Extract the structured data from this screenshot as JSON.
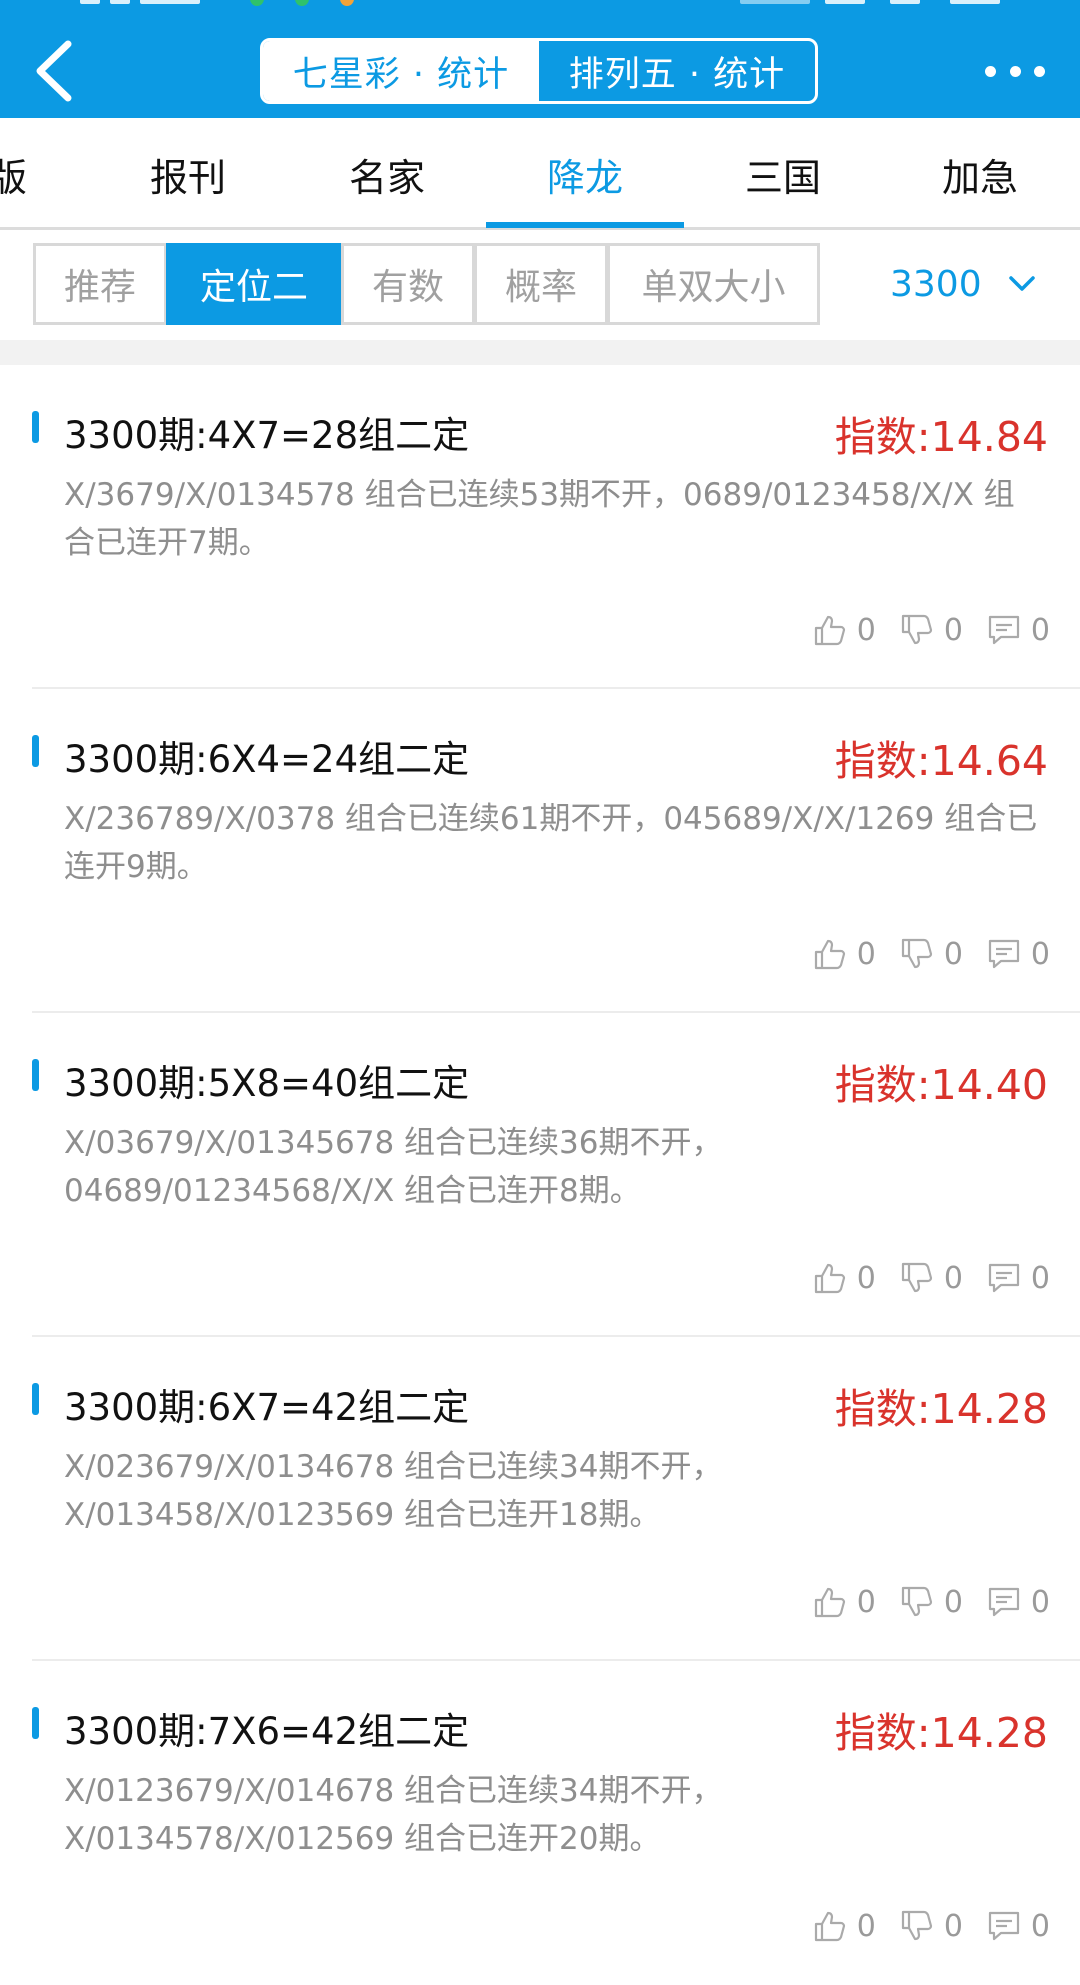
{
  "header": {
    "segments": [
      {
        "label": "七星彩 · 统计",
        "active": true
      },
      {
        "label": "排列五 · 统计",
        "active": false
      }
    ],
    "accent_color": "#0c9ae3"
  },
  "tabs": [
    {
      "label": "版",
      "active": false
    },
    {
      "label": "报刊",
      "active": false
    },
    {
      "label": "名家",
      "active": false
    },
    {
      "label": "降龙",
      "active": true
    },
    {
      "label": "三国",
      "active": false
    },
    {
      "label": "加急",
      "active": false
    }
  ],
  "filters": {
    "chips": [
      {
        "label": "推荐",
        "active": false
      },
      {
        "label": "定位二",
        "active": true
      },
      {
        "label": "有数",
        "active": false
      },
      {
        "label": "概率",
        "active": false
      },
      {
        "label": "单双大小",
        "active": false
      }
    ],
    "period_value": "3300"
  },
  "items": [
    {
      "title": "3300期:4X7=28组二定",
      "score": "指数:14.84",
      "desc": "X/3679/X/0134578 组合已连续53期不开，0689/0123458/X/X 组合已连开7期。",
      "likes": "0",
      "dislikes": "0",
      "comments": "0"
    },
    {
      "title": "3300期:6X4=24组二定",
      "score": "指数:14.64",
      "desc": "X/236789/X/0378 组合已连续61期不开，045689/X/X/1269 组合已连开9期。",
      "likes": "0",
      "dislikes": "0",
      "comments": "0"
    },
    {
      "title": "3300期:5X8=40组二定",
      "score": "指数:14.40",
      "desc": "X/03679/X/01345678 组合已连续36期不开，04689/01234568/X/X 组合已连开8期。",
      "likes": "0",
      "dislikes": "0",
      "comments": "0"
    },
    {
      "title": "3300期:6X7=42组二定",
      "score": "指数:14.28",
      "desc": "X/023679/X/0134678 组合已连续34期不开，X/013458/X/0123569 组合已连开18期。",
      "likes": "0",
      "dislikes": "0",
      "comments": "0"
    },
    {
      "title": "3300期:7X6=42组二定",
      "score": "指数:14.28",
      "desc": "X/0123679/X/014678 组合已连续34期不开，X/0134578/X/012569 组合已连开20期。",
      "likes": "0",
      "dislikes": "0",
      "comments": "0"
    }
  ],
  "colors": {
    "score": "#d9332c",
    "muted": "#8e8e8e"
  }
}
